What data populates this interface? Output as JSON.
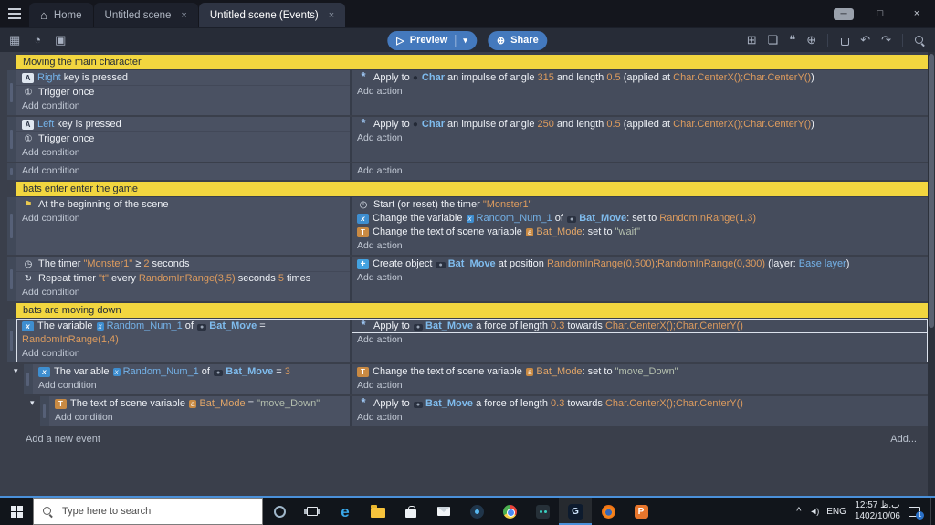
{
  "colors": {
    "accent_blue": "#4479bd",
    "comment_yellow": "#f2d63f",
    "taskbar_underline": "#4a90d9"
  },
  "titlebar": {
    "tabs": [
      {
        "label": "Home",
        "icon": "home-icon",
        "closable": false,
        "active": false
      },
      {
        "label": "Untitled scene",
        "closable": true,
        "active": false
      },
      {
        "label": "Untitled scene (Events)",
        "closable": true,
        "active": true
      }
    ]
  },
  "toolbar": {
    "left_icons": [
      "layout-icon",
      "history-icon",
      "scene-image-icon"
    ],
    "preview_label": "Preview",
    "share_label": "Share",
    "right_icons": [
      "add-event-icon",
      "add-subevent-icon",
      "add-comment-icon",
      "add-circle-icon",
      "trash-icon",
      "undo-icon",
      "redo-icon",
      "search-icon"
    ]
  },
  "sheet": {
    "add_condition_label": "Add condition",
    "add_action_label": "Add action",
    "footer_add_event": "Add a new event",
    "footer_add_more": "Add...",
    "events": [
      {
        "type": "comment",
        "text": "Moving the main character"
      },
      {
        "type": "event",
        "level": 0,
        "selected": false,
        "conditions": [
          {
            "icon": "key-icon",
            "segments": [
              [
                "Right",
                "param"
              ],
              [
                " key is pressed",
                "plain"
              ]
            ]
          },
          {
            "icon": "trigger-once-icon",
            "segments": [
              [
                "Trigger once",
                "plain"
              ]
            ]
          }
        ],
        "actions": [
          {
            "icon": "physics-icon",
            "segments": [
              [
                "Apply to ",
                "plain"
              ],
              [
                "●",
                "chipdot"
              ],
              [
                " Char",
                "objbold"
              ],
              [
                " an impulse of angle ",
                "plain"
              ],
              [
                "315",
                "expr"
              ],
              [
                " and length ",
                "plain"
              ],
              [
                "0.5",
                "expr"
              ],
              [
                " (applied at ",
                "plain"
              ],
              [
                "Char.CenterX();Char.CenterY()",
                "expr"
              ],
              [
                ")",
                "plain"
              ]
            ]
          }
        ]
      },
      {
        "type": "event",
        "level": 0,
        "selected": false,
        "conditions": [
          {
            "icon": "key-icon",
            "segments": [
              [
                "Left",
                "param"
              ],
              [
                " key is pressed",
                "plain"
              ]
            ]
          },
          {
            "icon": "trigger-once-icon",
            "segments": [
              [
                "Trigger once",
                "plain"
              ]
            ]
          }
        ],
        "actions": [
          {
            "icon": "physics-icon",
            "segments": [
              [
                "Apply to ",
                "plain"
              ],
              [
                "●",
                "chipdot"
              ],
              [
                " Char",
                "objbold"
              ],
              [
                " an impulse of angle ",
                "plain"
              ],
              [
                "250",
                "expr"
              ],
              [
                " and length ",
                "plain"
              ],
              [
                "0.5",
                "expr"
              ],
              [
                " (applied at ",
                "plain"
              ],
              [
                "Char.CenterX();Char.CenterY()",
                "expr"
              ],
              [
                ")",
                "plain"
              ]
            ]
          }
        ]
      },
      {
        "type": "event",
        "level": 0,
        "selected": false,
        "conditions": [],
        "actions": []
      },
      {
        "type": "comment",
        "text": "bats enter enter the game"
      },
      {
        "type": "event",
        "level": 0,
        "selected": false,
        "conditions": [
          {
            "icon": "flag-icon",
            "segments": [
              [
                "At the beginning of the scene",
                "plain"
              ]
            ]
          }
        ],
        "actions": [
          {
            "icon": "start-timer-icon",
            "segments": [
              [
                "Start (or reset) the timer ",
                "plain"
              ],
              [
                "\"Monster1\"",
                "expr"
              ]
            ]
          },
          {
            "icon": "variable-icon",
            "segments": [
              [
                "Change the variable ",
                "plain"
              ],
              [
                "x",
                "chipvar"
              ],
              [
                "Random_Num_1",
                "var"
              ],
              [
                " of ",
                "plain"
              ],
              [
                "●",
                "chipbat"
              ],
              [
                "Bat_Move",
                "objbold"
              ],
              [
                ": set to ",
                "plain"
              ],
              [
                "RandomInRange(1,3)",
                "expr"
              ]
            ]
          },
          {
            "icon": "text-variable-icon",
            "segments": [
              [
                "Change the text of scene variable ",
                "plain"
              ],
              [
                "a",
                "chiptxt"
              ],
              [
                "Bat_Mode",
                "var2"
              ],
              [
                ": set to ",
                "plain"
              ],
              [
                "\"wait\"",
                "str"
              ]
            ]
          }
        ]
      },
      {
        "type": "event",
        "level": 0,
        "selected": false,
        "conditions": [
          {
            "icon": "timer-icon",
            "segments": [
              [
                "The timer ",
                "plain"
              ],
              [
                "\"Monster1\"",
                "expr"
              ],
              [
                " ≥ ",
                "plain"
              ],
              [
                "2",
                "expr"
              ],
              [
                " seconds",
                "plain"
              ]
            ]
          },
          {
            "icon": "repeat-icon",
            "segments": [
              [
                "Repeat timer ",
                "plain"
              ],
              [
                "\"t\"",
                "expr"
              ],
              [
                " every ",
                "plain"
              ],
              [
                "RandomInRange(3,5)",
                "expr"
              ],
              [
                " seconds ",
                "plain"
              ],
              [
                "5",
                "expr"
              ],
              [
                " times",
                "plain"
              ]
            ]
          }
        ],
        "actions": [
          {
            "icon": "create-icon",
            "segments": [
              [
                "Create object ",
                "plain"
              ],
              [
                "●",
                "chipbat"
              ],
              [
                "Bat_Move",
                "objbold"
              ],
              [
                " at position ",
                "plain"
              ],
              [
                "RandomInRange(0,500);RandomInRange(0,300)",
                "expr"
              ],
              [
                " (layer: ",
                "plain"
              ],
              [
                "Base layer",
                "param"
              ],
              [
                ")",
                "plain"
              ]
            ]
          }
        ]
      },
      {
        "type": "comment",
        "text": "bats are moving down"
      },
      {
        "type": "event",
        "level": 0,
        "selected": true,
        "conditions": [
          {
            "icon": "variable-icon",
            "segments": [
              [
                "The variable ",
                "plain"
              ],
              [
                "x",
                "chipvar"
              ],
              [
                "Random_Num_1",
                "var"
              ],
              [
                " of ",
                "plain"
              ],
              [
                "●",
                "chipbat"
              ],
              [
                "Bat_Move",
                "objbold"
              ],
              [
                " = ",
                "plain"
              ],
              [
                "RandomInRange(1,4)",
                "expr"
              ]
            ]
          }
        ],
        "actions": [
          {
            "icon": "physics-icon",
            "selected": true,
            "segments": [
              [
                "Apply to ",
                "plain"
              ],
              [
                "●",
                "chipbat"
              ],
              [
                "Bat_Move",
                "objbold"
              ],
              [
                " a force of length ",
                "plain"
              ],
              [
                "0.3",
                "expr"
              ],
              [
                " towards ",
                "plain"
              ],
              [
                "Char.CenterX();Char.CenterY()",
                "expr"
              ]
            ]
          }
        ]
      },
      {
        "type": "event",
        "level": 1,
        "selected": false,
        "caret": true,
        "conditions": [
          {
            "icon": "variable-icon",
            "segments": [
              [
                "The variable ",
                "plain"
              ],
              [
                "x",
                "chipvar"
              ],
              [
                "Random_Num_1",
                "var"
              ],
              [
                " of ",
                "plain"
              ],
              [
                "●",
                "chipbat"
              ],
              [
                "Bat_Move",
                "objbold"
              ],
              [
                " = ",
                "plain"
              ],
              [
                "3",
                "expr"
              ]
            ]
          }
        ],
        "actions": [
          {
            "icon": "text-variable-icon",
            "segments": [
              [
                "Change the text of scene variable ",
                "plain"
              ],
              [
                "a",
                "chiptxt"
              ],
              [
                "Bat_Mode",
                "var2"
              ],
              [
                ": set to ",
                "plain"
              ],
              [
                "\"move_Down\"",
                "str"
              ]
            ]
          }
        ]
      },
      {
        "type": "event",
        "level": 2,
        "selected": false,
        "caret": true,
        "conditions": [
          {
            "icon": "text-variable-icon",
            "segments": [
              [
                "The text of scene variable ",
                "plain"
              ],
              [
                "a",
                "chiptxt"
              ],
              [
                "Bat_Mode",
                "var2"
              ],
              [
                " = ",
                "plain"
              ],
              [
                "\"move_Down\"",
                "str"
              ]
            ]
          }
        ],
        "actions": [
          {
            "icon": "physics-icon",
            "segments": [
              [
                "Apply to ",
                "plain"
              ],
              [
                "●",
                "chipbat"
              ],
              [
                "Bat_Move",
                "objbold"
              ],
              [
                " a force of length ",
                "plain"
              ],
              [
                "0.3",
                "expr"
              ],
              [
                " towards ",
                "plain"
              ],
              [
                "Char.CenterX();Char.CenterY()",
                "expr"
              ]
            ]
          }
        ]
      }
    ]
  },
  "taskbar": {
    "search_placeholder": "Type here to search",
    "apps": [
      "start-icon",
      "cortana-icon",
      "task-view-icon",
      "edge-icon",
      "file-explorer-icon",
      "store-icon",
      "mail-icon",
      "media-player-icon",
      "chrome-icon",
      "dark-app-icon",
      "gdevelop-icon",
      "firefox-icon",
      "photo-app-icon"
    ],
    "active_app": "gdevelop-icon",
    "tray": {
      "lang": "ENG",
      "time": "12:57 ب.ظ",
      "date": "1402/10/06",
      "badge": "1"
    }
  }
}
